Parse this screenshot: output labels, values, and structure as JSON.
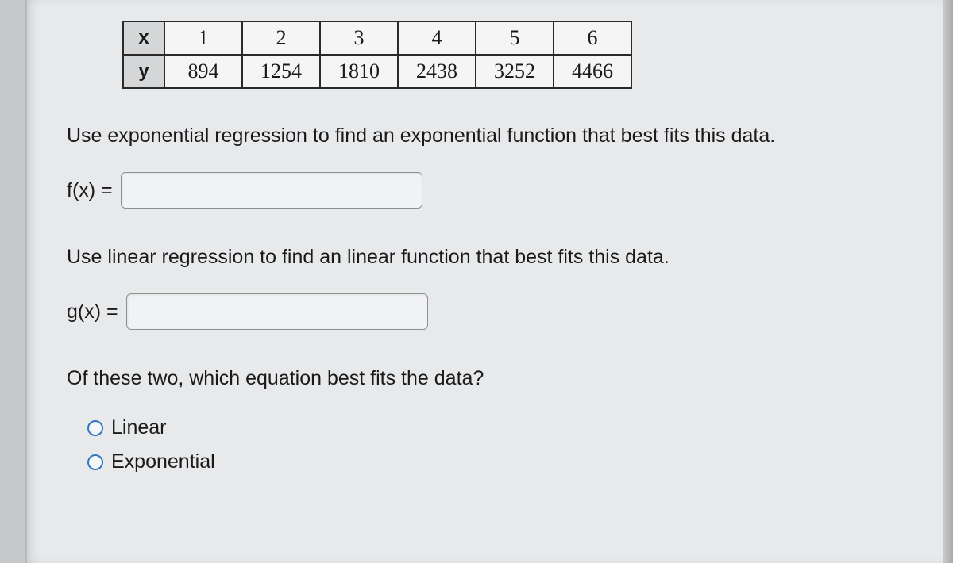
{
  "chart_data": {
    "type": "table",
    "row_labels": [
      "x",
      "y"
    ],
    "x": [
      1,
      2,
      3,
      4,
      5,
      6
    ],
    "y": [
      894,
      1254,
      1810,
      2438,
      3252,
      4466
    ]
  },
  "table": {
    "row1_label": "x",
    "row1": [
      "1",
      "2",
      "3",
      "4",
      "5",
      "6"
    ],
    "row2_label": "y",
    "row2": [
      "894",
      "1254",
      "1810",
      "2438",
      "3252",
      "4466"
    ]
  },
  "prompts": {
    "p1": "Use exponential regression to find an exponential function that best fits this data.",
    "p2": "Use linear regression to find an linear function that best fits this data.",
    "p3": "Of these two, which equation best fits the data?"
  },
  "equations": {
    "f_label": "f(x) =",
    "f_value": "",
    "g_label": "g(x) =",
    "g_value": ""
  },
  "options": {
    "opt1": "Linear",
    "opt2": "Exponential"
  }
}
